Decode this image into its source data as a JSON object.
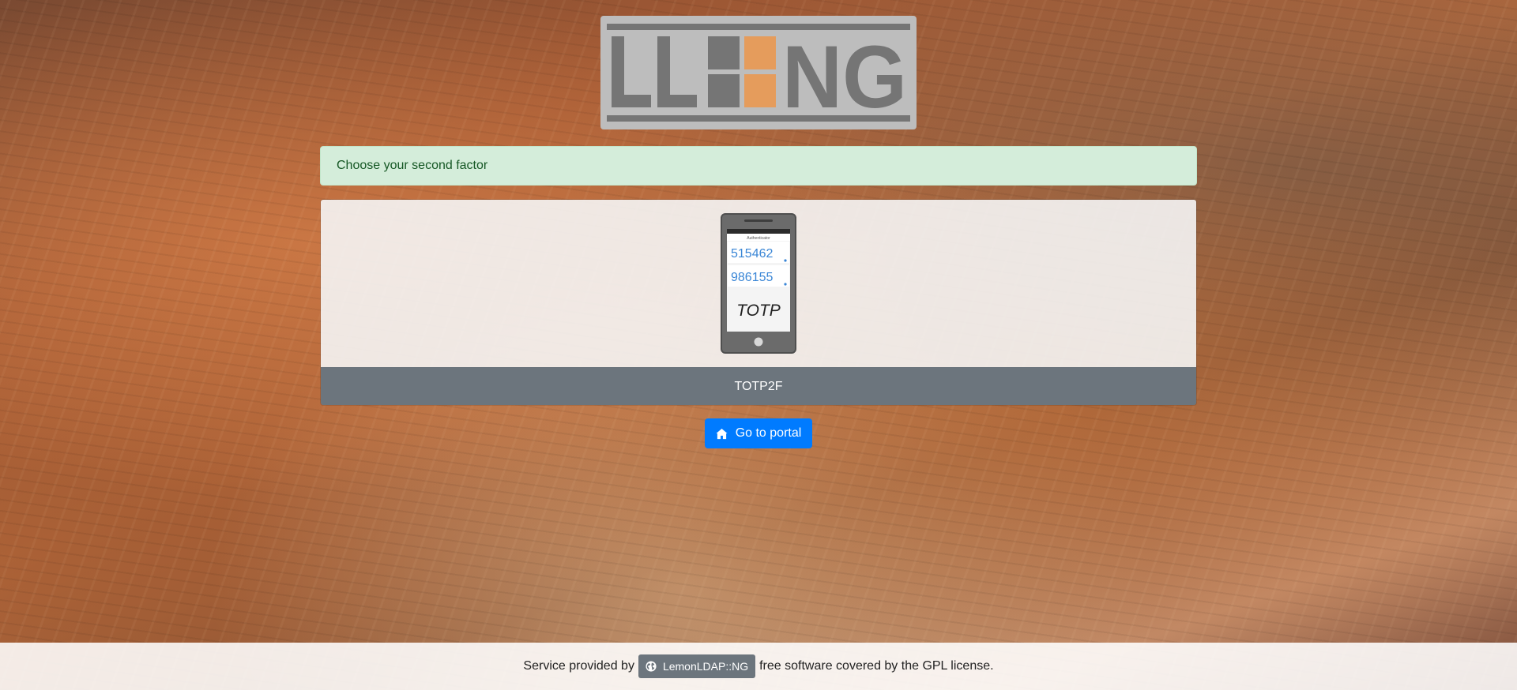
{
  "logo": {
    "text_left": "LL",
    "text_right": "NG",
    "colors": {
      "frame": "#bdbdbd",
      "letters": "#757575",
      "accent": "#e59c5c"
    }
  },
  "alert": {
    "message": "Choose your second factor",
    "color": "#155724",
    "background": "#d4edda"
  },
  "second_factor": {
    "label": "TOTP2F",
    "image": {
      "app_title": "Authenticator",
      "code_1": "515462",
      "code_2": "986155",
      "caption": "TOTP"
    }
  },
  "portal_button": {
    "label": "Go to portal",
    "icon": "home-icon"
  },
  "footer": {
    "prefix": "Service provided by",
    "link_label": "LemonLDAP::NG",
    "link_icon": "globe-icon",
    "suffix": "free software covered by the GPL license."
  }
}
